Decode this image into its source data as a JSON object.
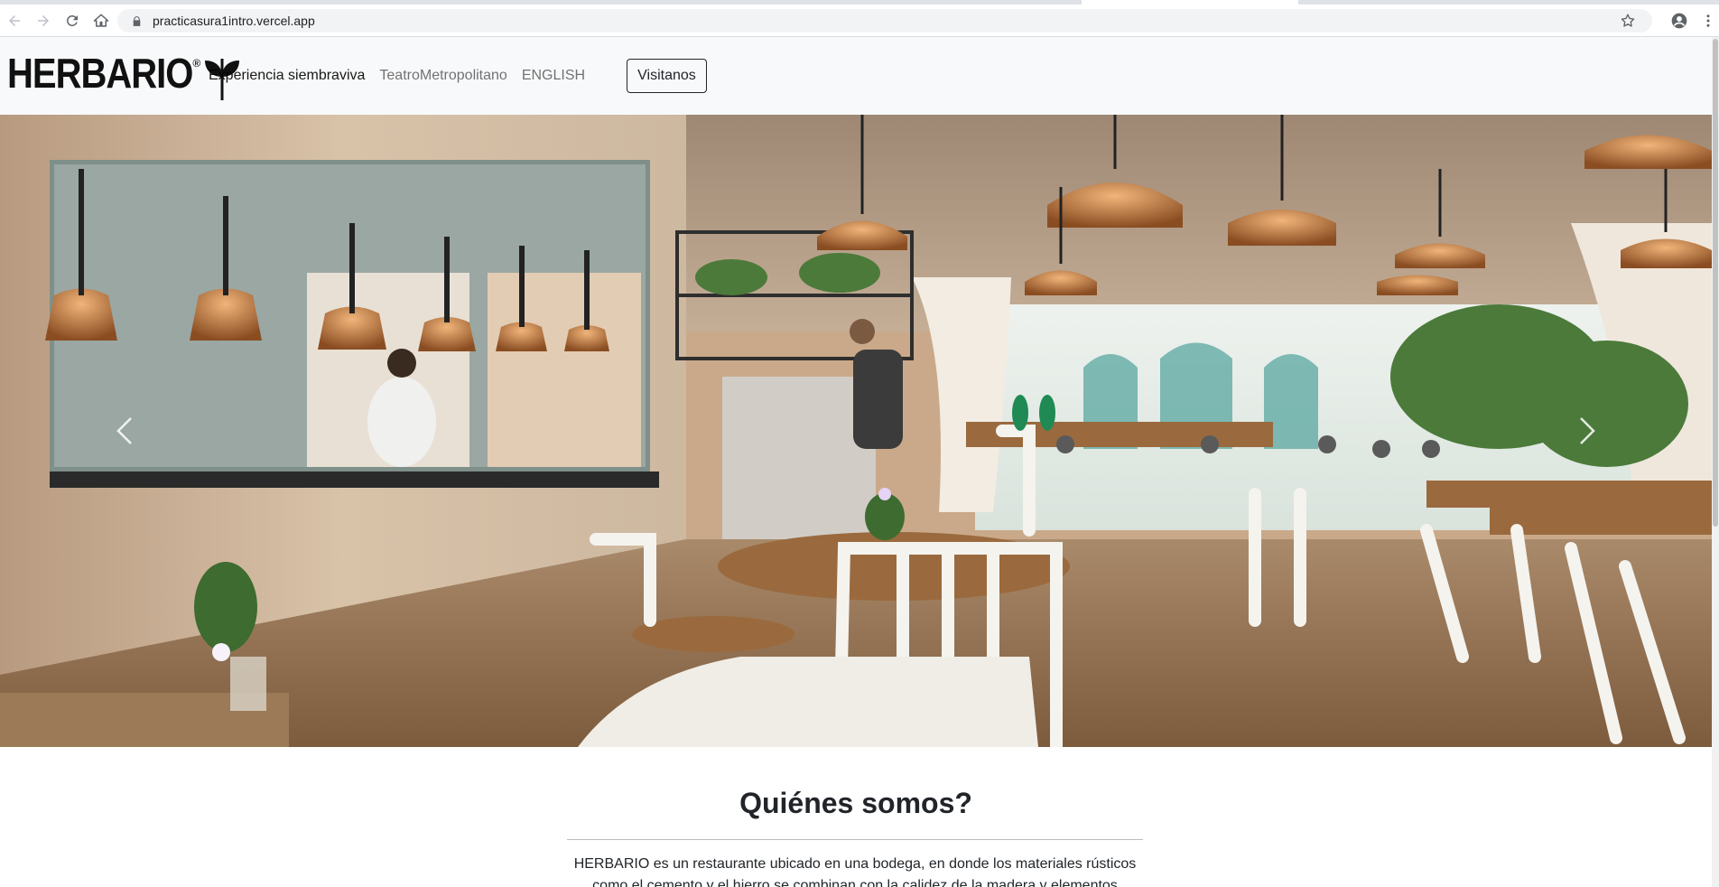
{
  "browser": {
    "url": "practicasura1intro.vercel.app",
    "icons": [
      "back-icon",
      "forward-icon",
      "reload-icon",
      "home-icon",
      "lock-icon",
      "star-icon",
      "profile-icon",
      "more-icon"
    ]
  },
  "navbar": {
    "brand": "HERBARIO",
    "brand_mark": "®",
    "links": [
      {
        "label": "Experiencia siembraviva"
      },
      {
        "label": "TeatroMetropolitano"
      },
      {
        "label": "ENGLISH"
      }
    ],
    "cta_label": "Visitanos"
  },
  "hero": {
    "image_subject": "restaurant interior",
    "icons": [
      "chevron-left-icon",
      "chevron-right-icon"
    ]
  },
  "about": {
    "title": "Quiénes somos?",
    "text_line1": "HERBARIO es un restaurante ubicado en una bodega, en donde los materiales rústicos",
    "text_line2": "como el cemento y el hierro se combinan con la calidez de la madera y elementos"
  },
  "colors": {
    "navbar_bg": "#f8f9fa",
    "text": "#212529",
    "hero_warm": "#c9a98a",
    "copper": "#b8733a"
  }
}
